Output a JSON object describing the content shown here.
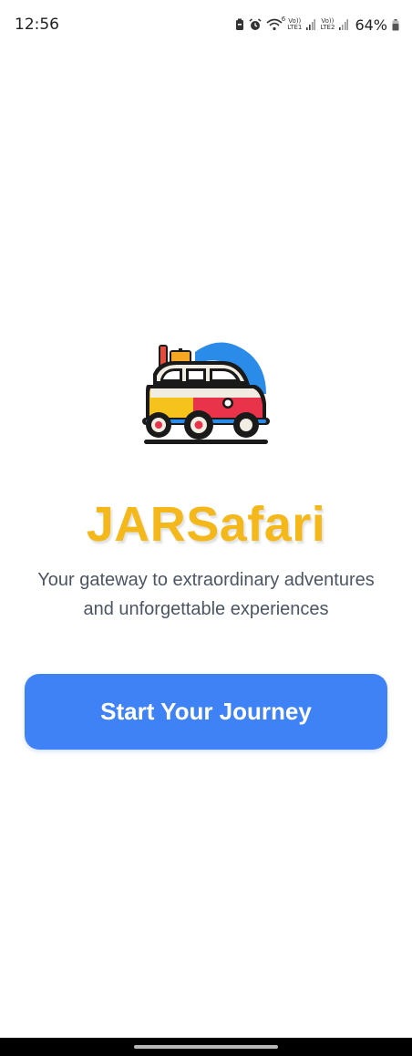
{
  "status_bar": {
    "time": "12:56",
    "battery": "64%",
    "network1": "LTE1",
    "network2": "LTE2",
    "wifi_tag": "6",
    "volte_tag": "Vo))",
    "icons": [
      "battery-saver-icon",
      "alarm-icon",
      "wifi-icon",
      "signal-icon",
      "signal-icon",
      "battery-icon"
    ]
  },
  "main": {
    "logo_icon": "van-logo-icon",
    "title": "JARSafari",
    "tagline_line1": "Your gateway to extraordinary adventures",
    "tagline_line2": "and unforgettable experiences",
    "cta_label": "Start Your Journey"
  },
  "colors": {
    "title": "#f5b81b",
    "button": "#3f82f5",
    "tagline": "#4b5563",
    "background": "#ffffff"
  }
}
